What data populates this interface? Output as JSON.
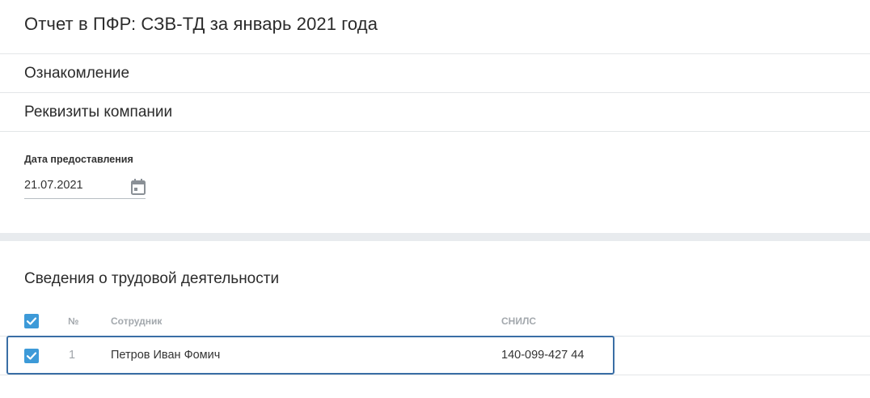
{
  "header": {
    "title": "Отчет в ПФР: СЗВ-ТД за январь 2021 года"
  },
  "sections": {
    "intro_label": "Ознакомление",
    "company_label": "Реквизиты компании"
  },
  "submission": {
    "date_label": "Дата предоставления",
    "date_value": "21.07.2021",
    "calendar_icon": "calendar-icon"
  },
  "employment": {
    "heading": "Сведения о трудовой деятельности",
    "columns": {
      "number": "№",
      "employee": "Сотрудник",
      "snils": "СНИЛС"
    },
    "select_all_checked": true,
    "rows": [
      {
        "checked": true,
        "number": "1",
        "employee": "Петров Иван Фомич",
        "snils": "140-099-427 44"
      }
    ]
  },
  "colors": {
    "accent": "#3d9ad8",
    "selection_border": "#3a6ea5",
    "divider": "#e3e6e8",
    "band": "#e8ebee"
  }
}
